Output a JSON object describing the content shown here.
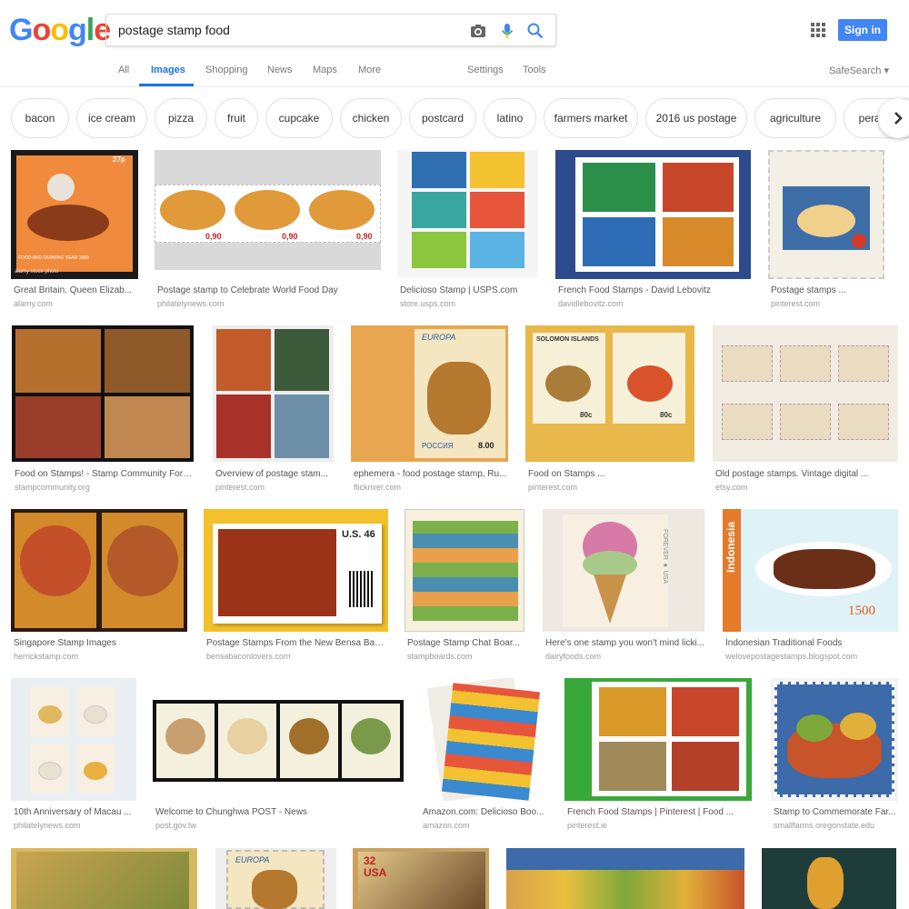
{
  "logo_letters": [
    {
      "ch": "G",
      "color": "#4285f4"
    },
    {
      "ch": "o",
      "color": "#ea4335"
    },
    {
      "ch": "o",
      "color": "#fbbc05"
    },
    {
      "ch": "g",
      "color": "#4285f4"
    },
    {
      "ch": "l",
      "color": "#34a853"
    },
    {
      "ch": "e",
      "color": "#ea4335"
    }
  ],
  "search": {
    "query": "postage stamp food"
  },
  "header": {
    "signin_label": "Sign in"
  },
  "tabs": {
    "all": "All",
    "images": "Images",
    "shopping": "Shopping",
    "news": "News",
    "maps": "Maps",
    "more": "More",
    "settings": "Settings",
    "tools": "Tools",
    "safesearch": "SafeSearch"
  },
  "chips": [
    "bacon",
    "ice cream",
    "pizza",
    "fruit",
    "cupcake",
    "chicken",
    "postcard",
    "latino",
    "farmers market",
    "2016 us postage",
    "agriculture",
    "peranakan"
  ],
  "results": [
    {
      "caption": "Great Britain. Queen Elizab...",
      "domain": "alamy.com"
    },
    {
      "caption": "Postage stamp to Celebrate World Food Day",
      "domain": "philatelynews.com"
    },
    {
      "caption": "Delicioso Stamp | USPS.com",
      "domain": "store.usps.com"
    },
    {
      "caption": "French Food Stamps - David Lebovitz",
      "domain": "davidlebovitz.com"
    },
    {
      "caption": "Postage stamps ...",
      "domain": "pinterest.com"
    },
    {
      "caption": "Food on Stamps! - Stamp Community Foru...",
      "domain": "stampcommunity.org"
    },
    {
      "caption": "Overview of postage stam...",
      "domain": "pinterest.com"
    },
    {
      "caption": "ephemera - food postage stamp, Ru...",
      "domain": "flickriver.com"
    },
    {
      "caption": "Food on Stamps ...",
      "domain": "pinterest.com"
    },
    {
      "caption": "Old postage stamps. Vintage digital ...",
      "domain": "etsy.com"
    },
    {
      "caption": "Singapore Stamp Images",
      "domain": "herrickstamp.com"
    },
    {
      "caption": "Postage Stamps From the New Bensa Bac...",
      "domain": "bensabaconlovers.com"
    },
    {
      "caption": "Postage Stamp Chat Boar...",
      "domain": "stampboards.com"
    },
    {
      "caption": "Here's one stamp you won't mind licki...",
      "domain": "dairyfoods.com"
    },
    {
      "caption": "Indonesian Traditional Foods",
      "domain": "welovepostagestamps.blogspot.com"
    },
    {
      "caption": "10th Anniversary of Macau ...",
      "domain": "philatelynews.com"
    },
    {
      "caption": "Welcome to Chunghwa POST - News",
      "domain": "post.gov.tw"
    },
    {
      "caption": "Amazon.com: Delicioso Boo...",
      "domain": "amazon.com"
    },
    {
      "caption": "French Food Stamps | Pinterest | Food ...",
      "domain": "pinterest.ie"
    },
    {
      "caption": "Stamp to Commemorate Far...",
      "domain": "smallfarms.oregonstate.edu"
    }
  ],
  "thumb_text": {
    "alamy": "alamy stock photo",
    "gb_value": "27p",
    "gb_year": "FOOD AND FARMING YEAR 1989",
    "wfd_price": "0,90",
    "ru_europa": "EUROPA",
    "ru_country": "РОССИЯ",
    "ru_price": "8.00",
    "solomon": "SOLOMON ISLANDS",
    "solomon_price": "80c",
    "us_price": "U.S. 46",
    "forever": "FOREVER ★ USA",
    "indo_country": "Indonesia",
    "indo_price": "1500",
    "usa32": "32 USA",
    "europa2": "EUROPA"
  },
  "colors": {
    "accent": "#1a73e8",
    "signin": "#4285f4",
    "gray": "#777777"
  }
}
